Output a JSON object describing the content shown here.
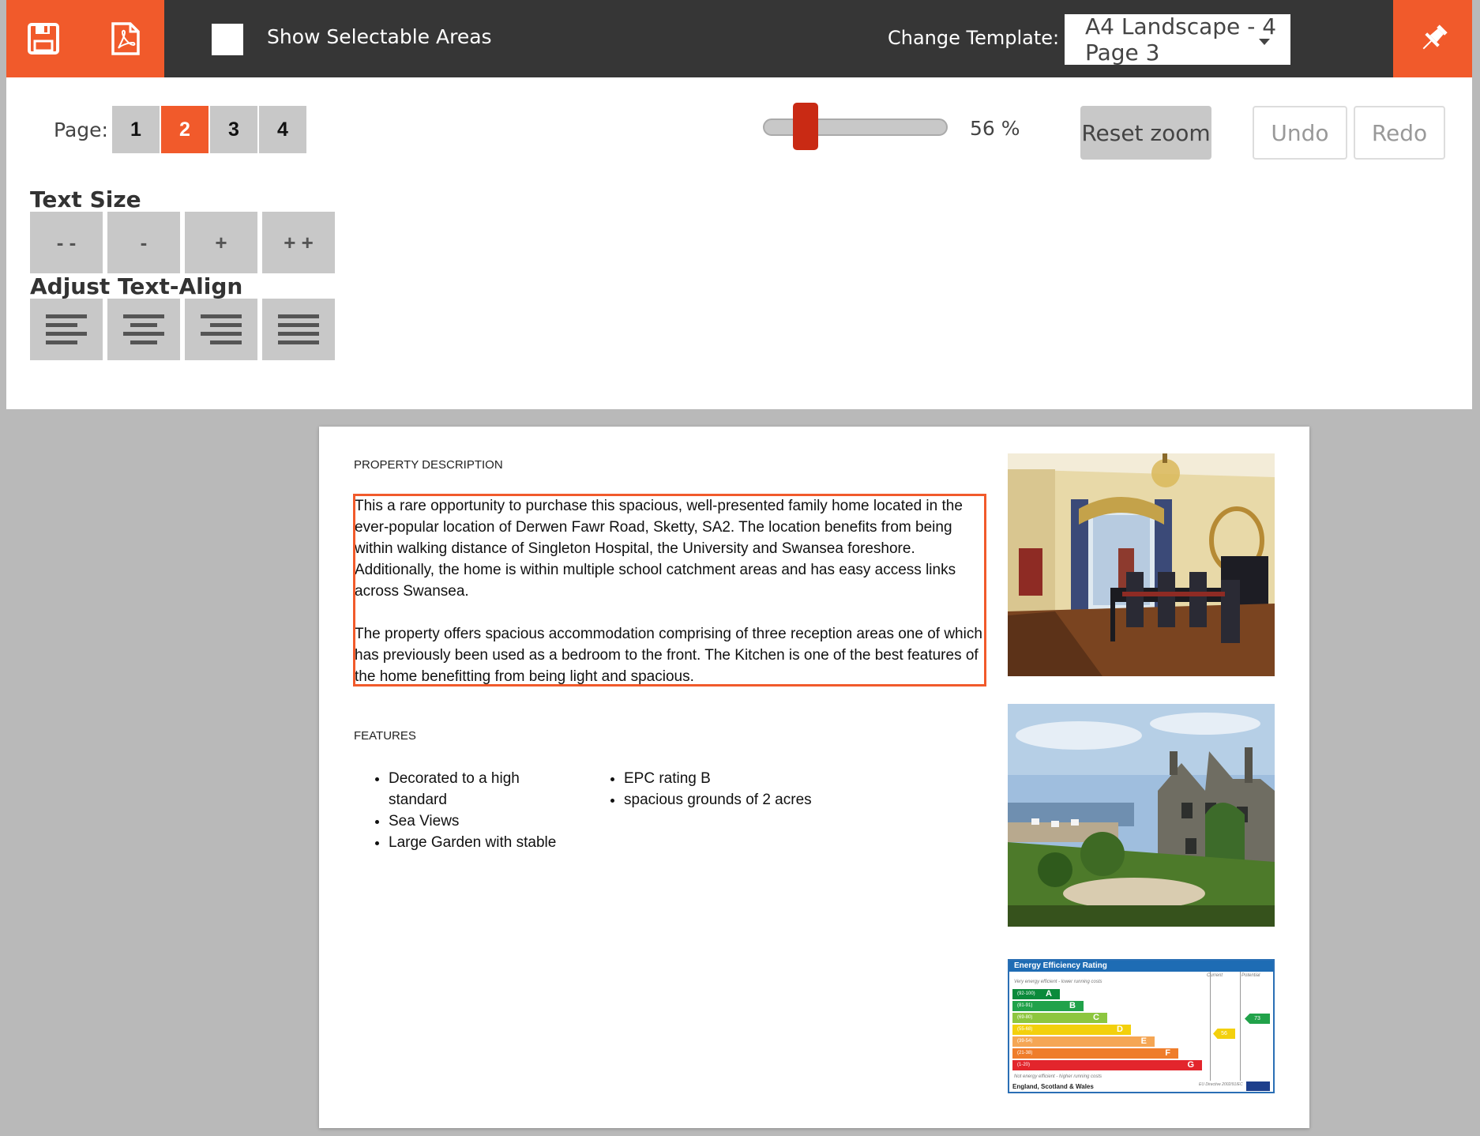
{
  "toolbar": {
    "show_selectable_label": "Show Selectable Areas",
    "change_template_label": "Change Template:",
    "template_value": "A4 Landscape - 4 Page 3"
  },
  "pager": {
    "label": "Page:",
    "pages": [
      "1",
      "2",
      "3",
      "4"
    ],
    "active_page": "2"
  },
  "zoom": {
    "value": 0.56,
    "label": "56 %",
    "reset_label": "Reset zoom",
    "undo_label": "Undo",
    "redo_label": "Redo"
  },
  "text_size": {
    "heading": "Text Size",
    "buttons": [
      "- -",
      "-",
      "+",
      "+ +"
    ]
  },
  "text_align": {
    "heading": "Adjust Text-Align",
    "icons": [
      "align-left-icon",
      "align-center-icon",
      "align-right-icon",
      "align-justify-icon"
    ]
  },
  "document": {
    "description_heading": "PROPERTY DESCRIPTION",
    "description_paragraphs": [
      "This a rare opportunity to purchase this spacious, well-presented family home located in the ever-popular location of Derwen Fawr Road, Sketty, SA2. The location benefits from being within walking distance of Singleton Hospital, the University and Swansea foreshore. Additionally, the home is within multiple school catchment areas and has easy access links across Swansea.",
      "The property offers spacious accommodation comprising of three reception areas one of which has previously been used as a bedroom to the front. The Kitchen is one of the best features of the home benefitting from being light and spacious."
    ],
    "features_heading": "FEATURES",
    "features_col1": [
      "Decorated to a high standard",
      "Sea Views",
      "Large Garden with stable"
    ],
    "features_col2": [
      "EPC rating B",
      "spacious grounds of 2 acres"
    ],
    "epc": {
      "title": "Energy Efficiency Rating",
      "col_current": "Current",
      "col_potential": "Potential",
      "top_note": "Very energy efficient - lower running costs",
      "bottom_note": "Not energy efficient - higher running costs",
      "bands": [
        {
          "range": "(92-100)",
          "letter": "A",
          "color": "#0b8a3b"
        },
        {
          "range": "(81-91)",
          "letter": "B",
          "color": "#21a24a"
        },
        {
          "range": "(69-80)",
          "letter": "C",
          "color": "#8dc63f"
        },
        {
          "range": "(55-68)",
          "letter": "D",
          "color": "#f3d00c"
        },
        {
          "range": "(39-54)",
          "letter": "E",
          "color": "#f5a654"
        },
        {
          "range": "(21-38)",
          "letter": "F",
          "color": "#ef7d2b"
        },
        {
          "range": "(1-20)",
          "letter": "G",
          "color": "#e3252c"
        }
      ],
      "current": "56",
      "potential": "73",
      "region": "England, Scotland & Wales",
      "directive": "EU Directive 2002/91/EC"
    }
  },
  "colors": {
    "accent": "#f15a2b",
    "topbar": "#363636",
    "button_grey": "#c8c8c8"
  }
}
